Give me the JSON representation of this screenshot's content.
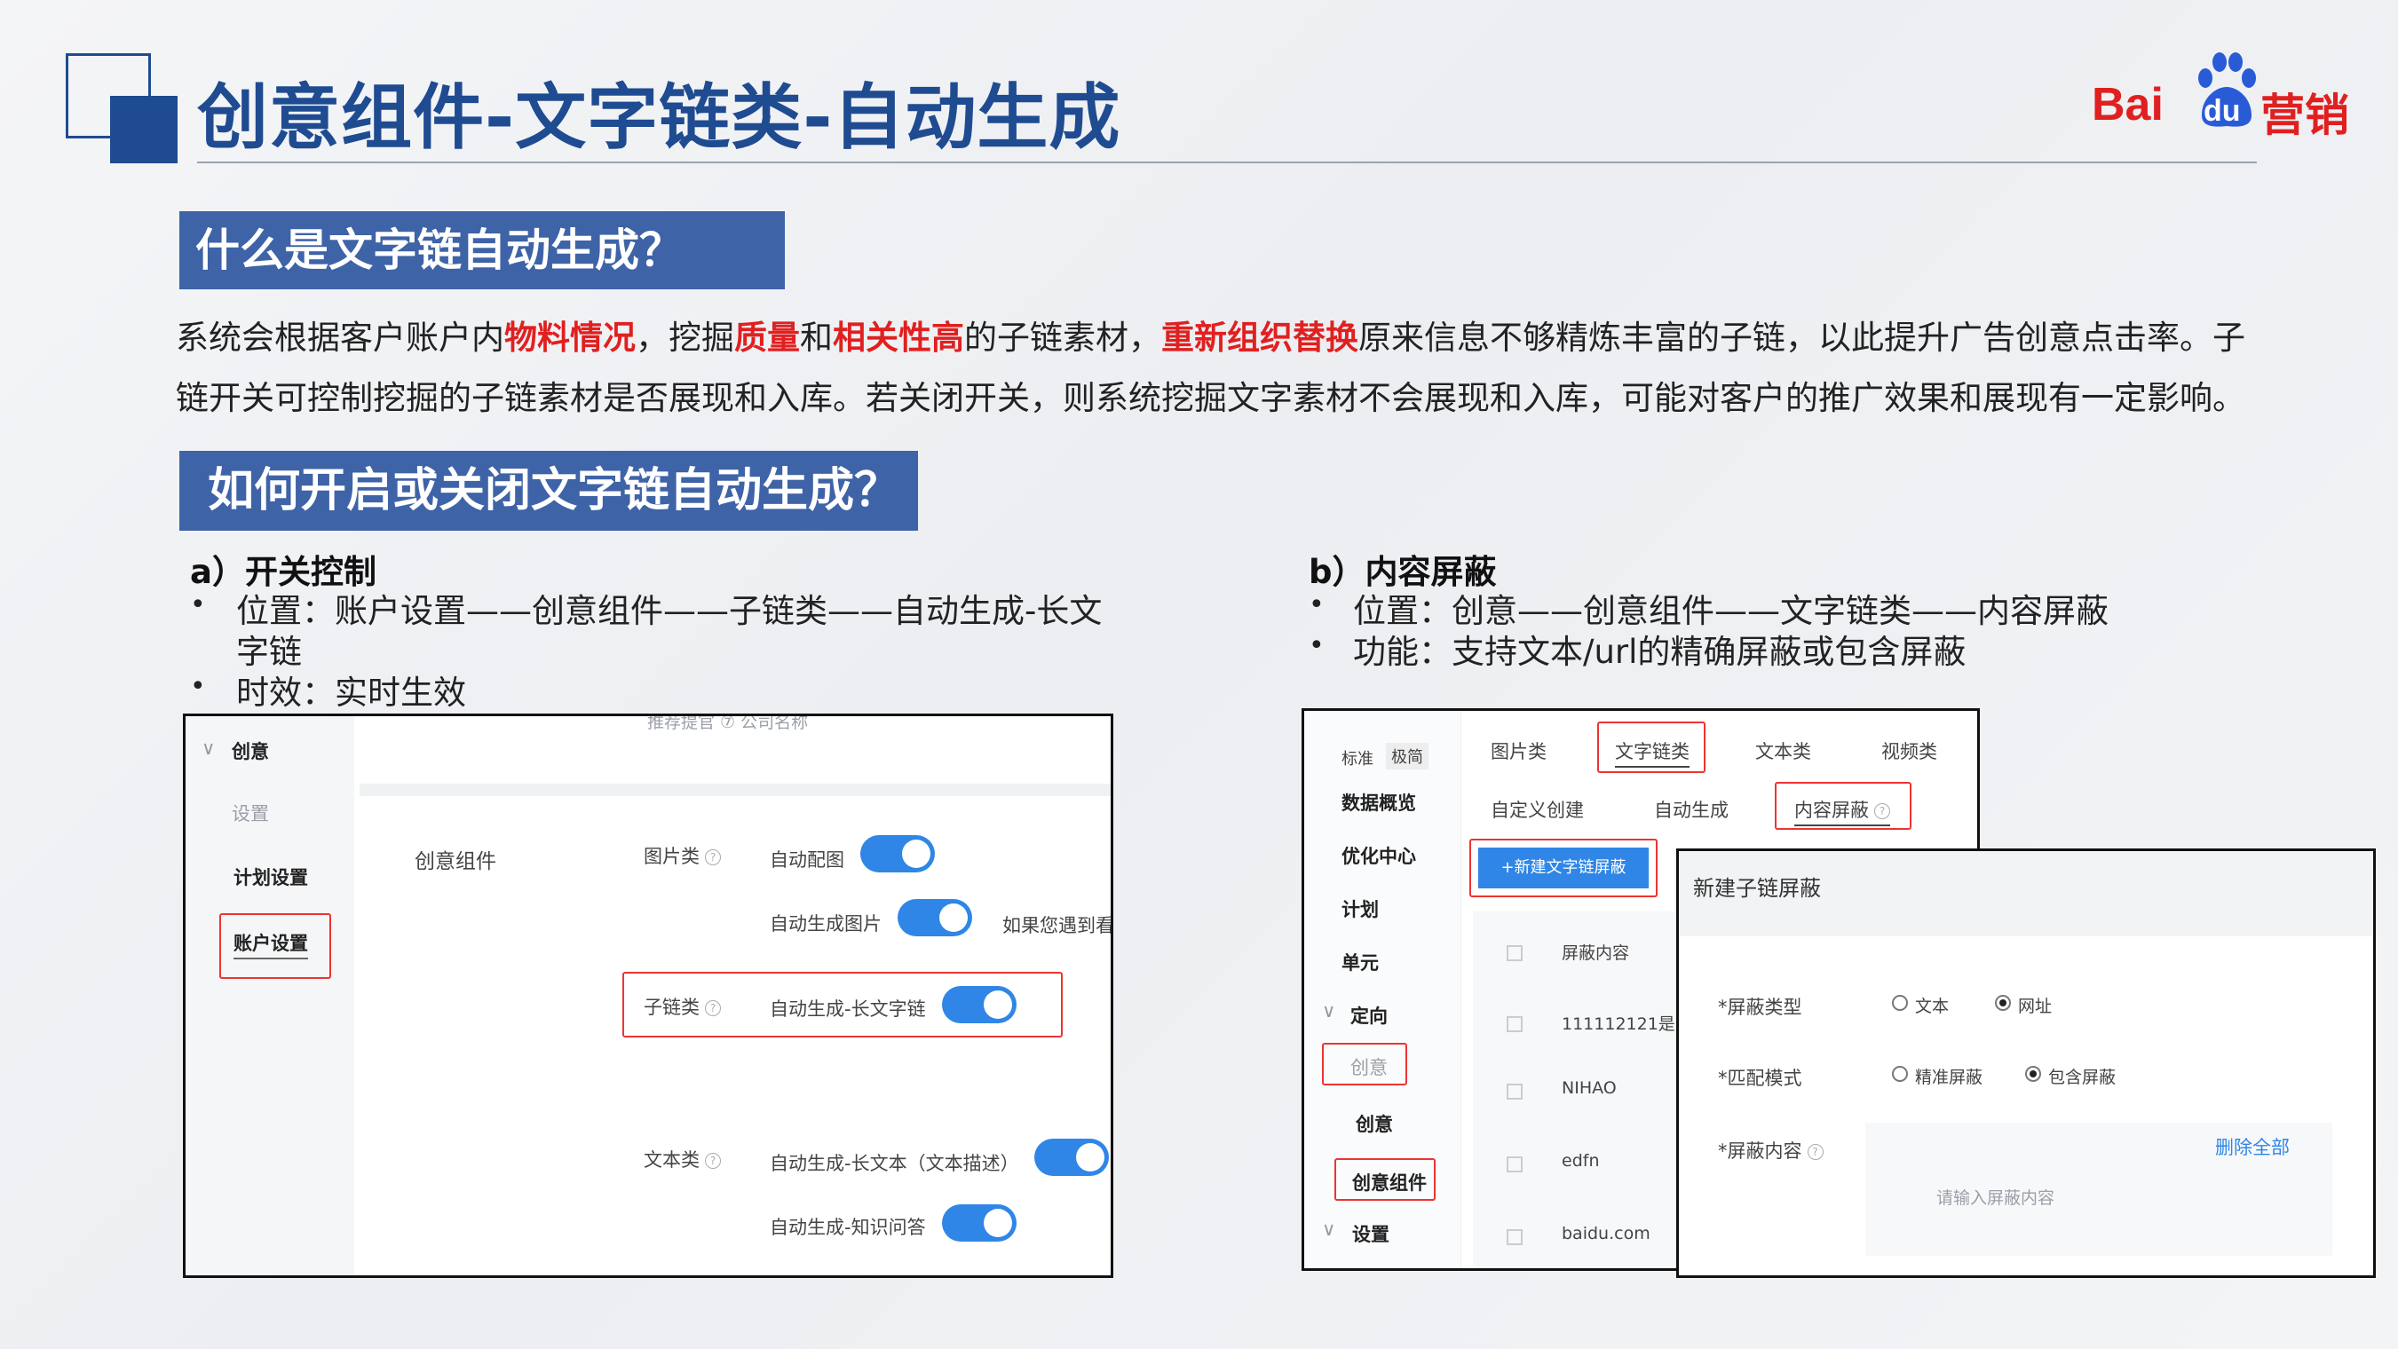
{
  "header": {
    "title": "创意组件-文字链类-自动生成",
    "logo_text_bai": "Bai",
    "logo_text_du": "du",
    "logo_text_yx": "营销",
    "brand_color": "#1f4b91",
    "logo_color": "#e02020"
  },
  "section1": {
    "heading": "什么是文字链自动生成？",
    "p1": {
      "s1": "系统会根据客户账户内",
      "r1": "物料情况",
      "s2": "，挖掘",
      "r2": "质量",
      "s3": "和",
      "r3": "相关性高",
      "s4": "的子链素材，",
      "r4": "重新组织替换",
      "s5": "原来信息不够精炼丰富的子链，以此提升广告创意点击率。子"
    },
    "p2": "链开关可控制挖掘的子链素材是否展现和入库。若关闭开关，则系统挖掘文字素材不会展现和入库，可能对客户的推广效果和展现有一定影响。"
  },
  "section2": {
    "heading": "如何开启或关闭文字链自动生成？",
    "a": {
      "heading": "a）开关控制",
      "b1_line1": "位置：账户设置——创意组件——子链类——自动生成-长文",
      "b1_line2": "字链",
      "b2": "时效：实时生效"
    },
    "b": {
      "heading": "b）内容屏蔽",
      "b1": "位置：创意——创意组件——文字链类——内容屏蔽",
      "b2": "功能：支持文本/url的精确屏蔽或包含屏蔽"
    }
  },
  "shotA": {
    "top_cut": "推荐提官 ⑦  公司名称",
    "nav_creative": "创意",
    "nav_settings": "设置",
    "nav_plan_settings": "计划设置",
    "nav_account_settings": "账户设置",
    "group_label": "创意组件",
    "image_cat": "图片类",
    "auto_match_image": "自动配图",
    "auto_gen_image": "自动生成图片",
    "cut_hint": "如果您遇到看",
    "sublink_cat": "子链类",
    "auto_gen_long_link": "自动生成-长文字链",
    "text_cat": "文本类",
    "auto_gen_long_text": "自动生成-长文本（文本描述）",
    "auto_gen_qa": "自动生成-知识问答"
  },
  "shotB": {
    "mode_standard": "标准",
    "mode_simple": "极简",
    "nav": [
      "数据概览",
      "优化中心",
      "计划",
      "单元",
      "定向",
      "创意",
      "创意",
      "创意组件",
      "设置"
    ],
    "tabs": [
      "图片类",
      "文字链类",
      "文本类",
      "视频类"
    ],
    "subtabs": [
      "自定义创建",
      "自动生成",
      "内容屏蔽"
    ],
    "new_button": "+新建文字链屏蔽",
    "table_header": "屏蔽内容",
    "rows": [
      "111112121是",
      "NIHAO",
      "edfn",
      "baidu.com"
    ],
    "dialog": {
      "title": "新建子链屏蔽",
      "type_label": "*屏蔽类型",
      "type_opt1": "文本",
      "type_opt2": "网址",
      "mode_label": "*匹配模式",
      "mode_opt1": "精准屏蔽",
      "mode_opt2": "包含屏蔽",
      "content_label": "*屏蔽内容",
      "delete_all": "删除全部",
      "placeholder": "请输入屏蔽内容"
    }
  }
}
